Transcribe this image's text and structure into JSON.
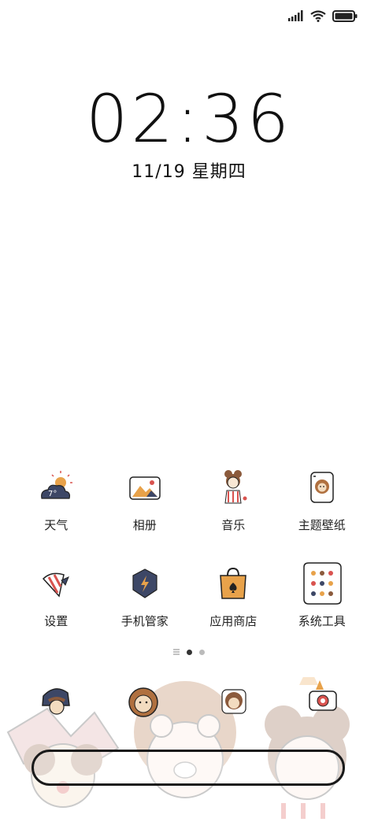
{
  "clock": {
    "time": "02:36",
    "date": "11/19 星期四"
  },
  "status": {
    "signal_icon": "signal-icon",
    "wifi_icon": "wifi-icon",
    "battery_icon": "battery-icon"
  },
  "apps": [
    {
      "label": "天气",
      "icon": "weather-icon"
    },
    {
      "label": "相册",
      "icon": "gallery-icon"
    },
    {
      "label": "音乐",
      "icon": "music-icon"
    },
    {
      "label": "主题壁纸",
      "icon": "theme-icon"
    },
    {
      "label": "设置",
      "icon": "settings-icon"
    },
    {
      "label": "手机管家",
      "icon": "security-icon"
    },
    {
      "label": "应用商店",
      "icon": "app-store-icon"
    },
    {
      "label": "系统工具",
      "icon": "tools-folder-icon"
    }
  ],
  "weather_temp": "7°",
  "pages": {
    "count": 2,
    "current": 1
  },
  "colors": {
    "navy": "#3d4766",
    "orange": "#e8a24a",
    "brown": "#8b5a3c",
    "red": "#d9534f",
    "cream": "#f3dcc0"
  }
}
